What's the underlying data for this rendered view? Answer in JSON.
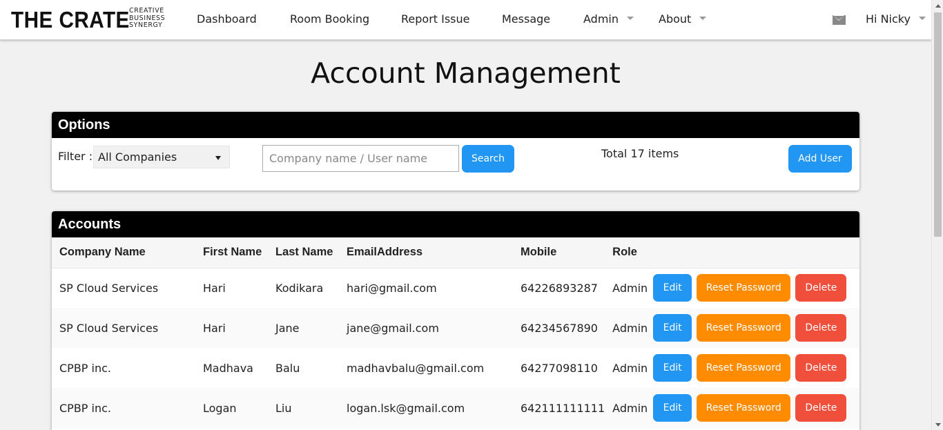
{
  "brand": {
    "name": "THE CRATE",
    "tagline": [
      "CREATIVE",
      "BUSINESS",
      "SYNERGY"
    ]
  },
  "nav": {
    "items": [
      {
        "label": "Dashboard"
      },
      {
        "label": "Room Booking"
      },
      {
        "label": "Report Issue"
      },
      {
        "label": "Message"
      },
      {
        "label": "Admin"
      },
      {
        "label": "About"
      }
    ],
    "greeting": "Hi Nicky",
    "mail_icon": "envelope-icon"
  },
  "page": {
    "title": "Account Management"
  },
  "options": {
    "header": "Options",
    "filter_label": "Filter :",
    "filter_value": "All Companies",
    "search_placeholder": "Company name / User name",
    "search_label": "Search",
    "total_text": "Total 17 items",
    "add_user_label": "Add User"
  },
  "accounts": {
    "header": "Accounts",
    "columns": [
      "Company Name",
      "First Name",
      "Last Name",
      "EmailAddress",
      "Mobile",
      "Role"
    ],
    "rows": [
      {
        "company": "SP Cloud Services",
        "first": "Hari",
        "last": "Kodikara",
        "email": "hari@gmail.com",
        "mobile": "64226893287",
        "role": "Admin"
      },
      {
        "company": "SP Cloud Services",
        "first": "Hari",
        "last": "Jane",
        "email": "jane@gmail.com",
        "mobile": "64234567890",
        "role": "Admin"
      },
      {
        "company": "CPBP inc.",
        "first": "Madhava",
        "last": "Balu",
        "email": "madhavbalu@gmail.com",
        "mobile": "64277098110",
        "role": "Admin"
      },
      {
        "company": "CPBP inc.",
        "first": "Logan",
        "last": "Liu",
        "email": "logan.lsk@gmail.com",
        "mobile": "642111111111",
        "role": "Admin"
      }
    ],
    "actions": {
      "edit": "Edit",
      "reset": "Reset Password",
      "delete": "Delete"
    }
  },
  "colors": {
    "primary": "#2196f3",
    "warning": "#ff8c00",
    "danger": "#f04f3c",
    "panel_header": "#000000"
  }
}
